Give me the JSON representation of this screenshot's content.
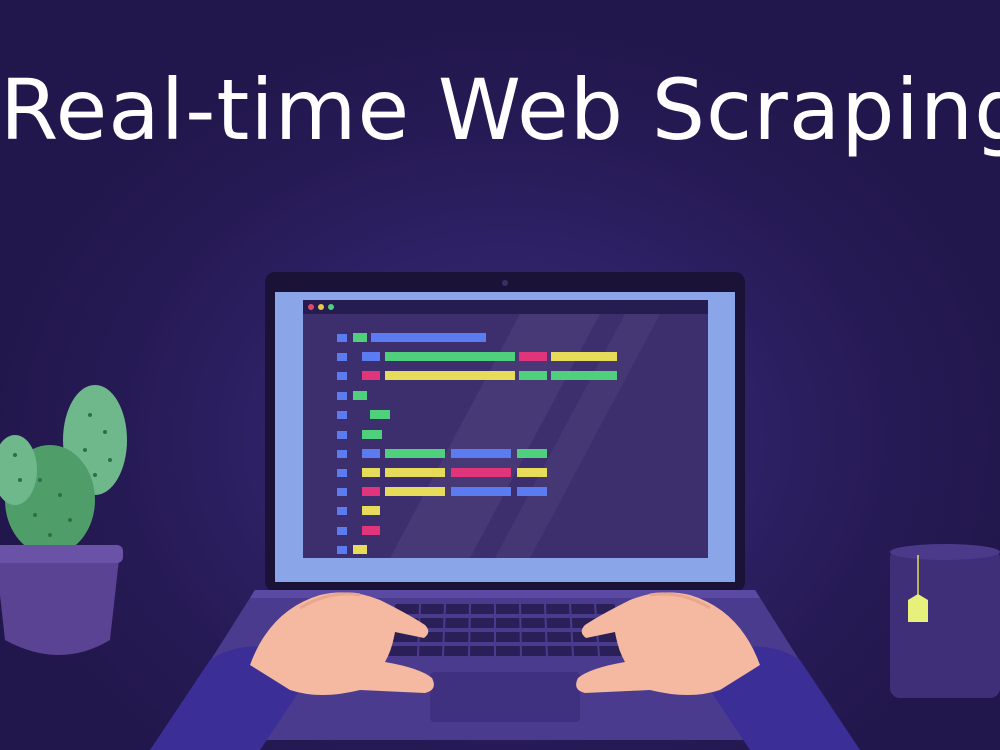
{
  "title": "Real-time Web Scraping",
  "colors": {
    "background": "#2a1d5c",
    "screen_window": "#3d2f6e",
    "code_blue": "#5b7cf0",
    "code_green": "#4fd07c",
    "code_pink": "#e0357a",
    "code_yellow": "#e7dc5a",
    "hand": "#f4b9a0",
    "sleeve": "#3b2e96"
  },
  "icons": {
    "plant": "cactus-icon",
    "mug": "mug-icon",
    "tea_tag": "tea-tag-icon",
    "laptop": "laptop-icon"
  }
}
